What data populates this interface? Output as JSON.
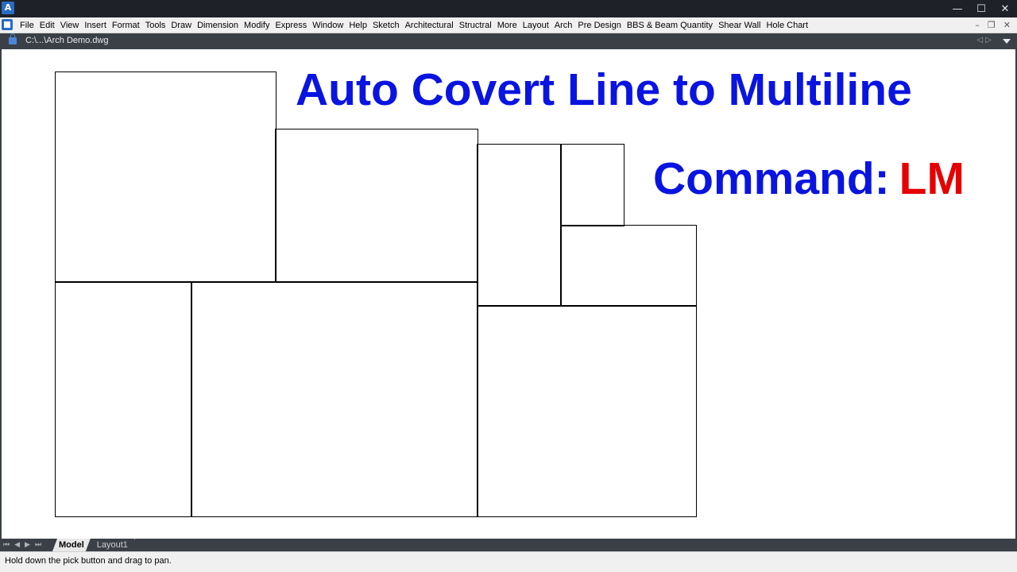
{
  "window": {
    "logo_glyph": "A",
    "controls": {
      "minimize": "—",
      "maximize": "☐",
      "close": "✕"
    }
  },
  "menubar": {
    "items": [
      "File",
      "Edit",
      "View",
      "Insert",
      "Format",
      "Tools",
      "Draw",
      "Dimension",
      "Modify",
      "Express",
      "Window",
      "Help",
      "Sketch",
      "Architectural",
      "Structral",
      "More",
      "Layout",
      "Arch",
      "Pre Design",
      "BBS & Beam Quantity",
      "Shear Wall",
      "Hole Chart"
    ],
    "doc_controls": {
      "minimize": "–",
      "restore": "❐",
      "close": "✕"
    }
  },
  "document": {
    "name": "C:\\...\\Arch Demo.dwg",
    "nav": "◁ ▷"
  },
  "drawing": {
    "headline": "Auto Covert Line to Multiline",
    "command_label": "Command:",
    "command_value": "LM",
    "colors": {
      "headline": "#0a14e0",
      "command_value": "#e60000",
      "lines": "#000000"
    }
  },
  "layout_tabs": {
    "arrows": [
      "⏮",
      "◀",
      "▶",
      "⏭"
    ],
    "tabs": [
      {
        "label": "Model",
        "active": true
      },
      {
        "label": "Layout1",
        "active": false
      }
    ]
  },
  "status": {
    "message": "Hold down the pick button and drag to pan."
  }
}
